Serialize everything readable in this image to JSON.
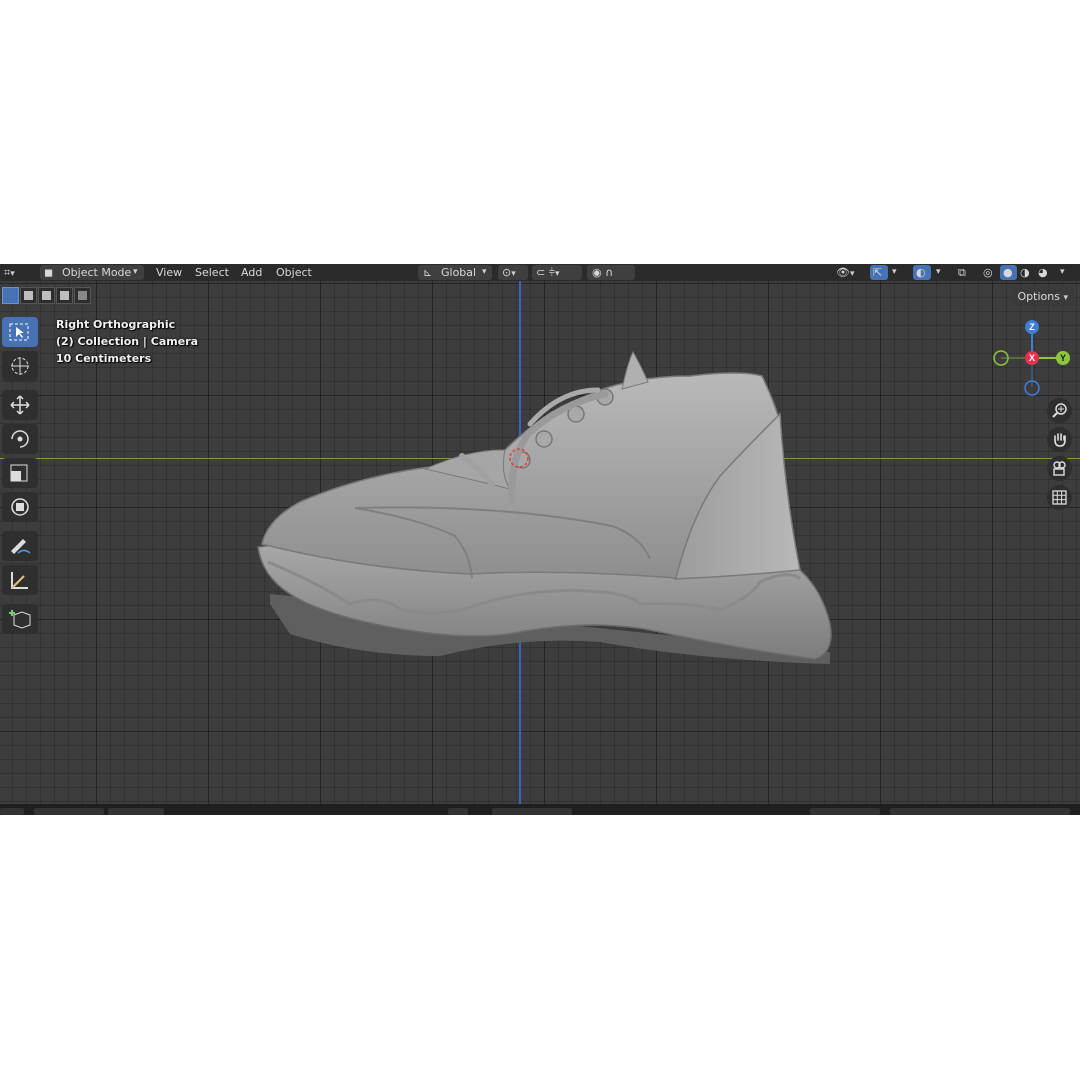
{
  "header": {
    "mode": "Object Mode",
    "menus": [
      "View",
      "Select",
      "Add",
      "Object"
    ],
    "orientation": "Global"
  },
  "options_label": "Options",
  "overlay": {
    "view_name": "Right Orthographic",
    "collection": "(2) Collection | Camera",
    "scale": "10 Centimeters"
  },
  "gizmo": {
    "z": "Z",
    "x": "X",
    "y": "Y"
  },
  "colors": {
    "axis_x": "#e0334e",
    "axis_y": "#8cc63f",
    "axis_z": "#3d7fd8",
    "accent": "#4772b3"
  },
  "tools": [
    "select-box-icon",
    "cursor-icon",
    "move-icon",
    "rotate-icon",
    "scale-icon",
    "transform-icon",
    "annotate-icon",
    "measure-icon",
    "add-cube-icon"
  ],
  "nav": [
    "zoom-icon",
    "hand-pan-icon",
    "camera-view-icon",
    "grid-ortho-icon"
  ]
}
